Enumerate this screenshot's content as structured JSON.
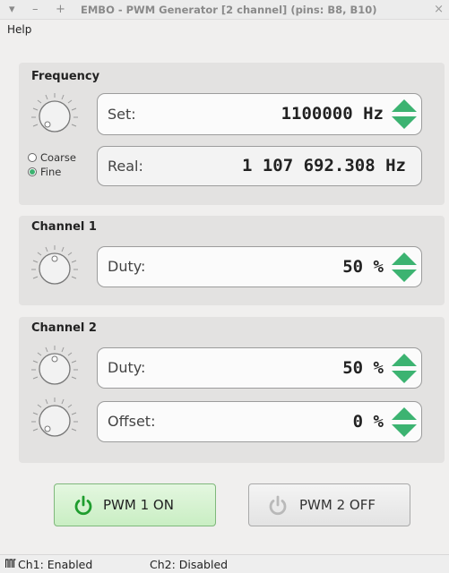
{
  "window": {
    "title": "EMBO - PWM Generator [2 channel] (pins: B8, B10)",
    "controls": [
      "▾",
      "–",
      "+"
    ],
    "close": "×"
  },
  "menu": {
    "help": "Help"
  },
  "frequency": {
    "title": "Frequency",
    "set_label": "Set:",
    "set_value": "1100000 Hz",
    "real_label": "Real:",
    "real_value": "1 107 692.308 Hz",
    "mode_options": [
      "Coarse",
      "Fine"
    ],
    "mode_selected": "Fine"
  },
  "channel1": {
    "title": "Channel 1",
    "duty_label": "Duty:",
    "duty_value": "50 %"
  },
  "channel2": {
    "title": "Channel 2",
    "duty_label": "Duty:",
    "duty_value": "50 %",
    "offset_label": "Offset:",
    "offset_value": "0 %"
  },
  "buttons": {
    "pwm1": "PWM 1 ON",
    "pwm2": "PWM 2 OFF"
  },
  "status": {
    "icon": "pulse-icon",
    "ch1": "Ch1: Enabled",
    "ch2": "Ch2: Disabled"
  },
  "colors": {
    "accent": "#3cb371",
    "on_button": "#c9eec3",
    "power_on_icon": "#1f9d2e",
    "power_off_icon": "#b9b9b9"
  }
}
